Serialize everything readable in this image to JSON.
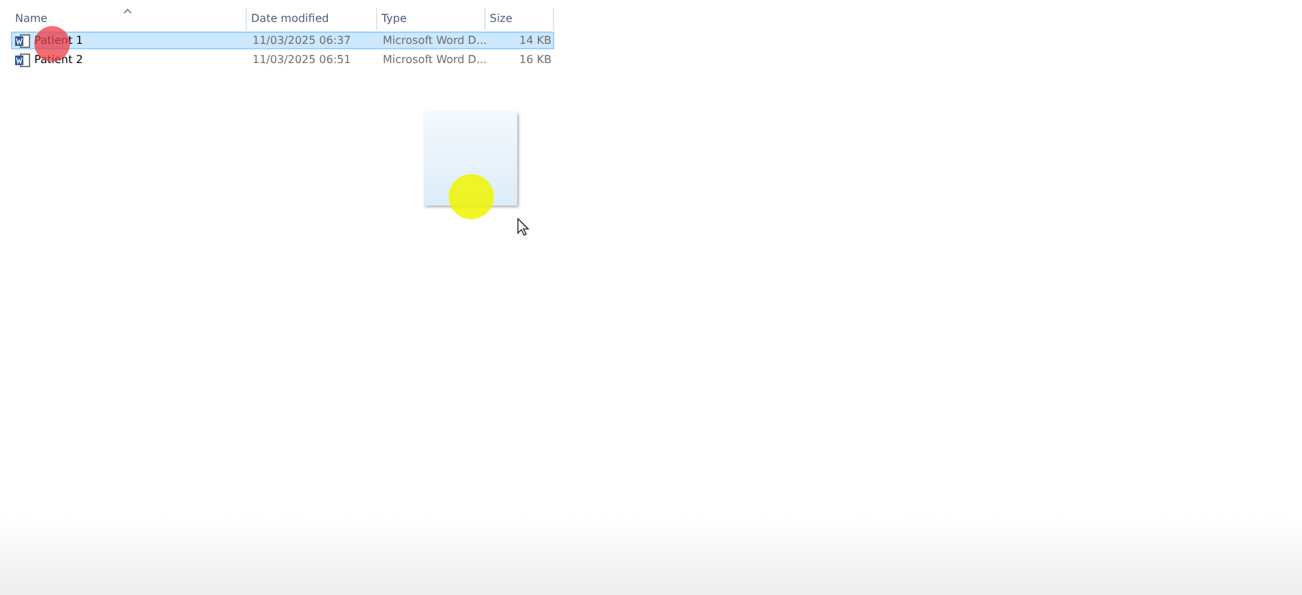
{
  "columns": [
    {
      "label": "Name"
    },
    {
      "label": "Date modified"
    },
    {
      "label": "Type"
    },
    {
      "label": "Size"
    }
  ],
  "rows": [
    {
      "name": "Patient 1",
      "modified": "11/03/2025 06:37",
      "type": "Microsoft Word D...",
      "size": "14 KB",
      "selected": true
    },
    {
      "name": "Patient 2",
      "modified": "11/03/2025 06:51",
      "type": "Microsoft Word D...",
      "size": "16 KB",
      "selected": false
    }
  ]
}
